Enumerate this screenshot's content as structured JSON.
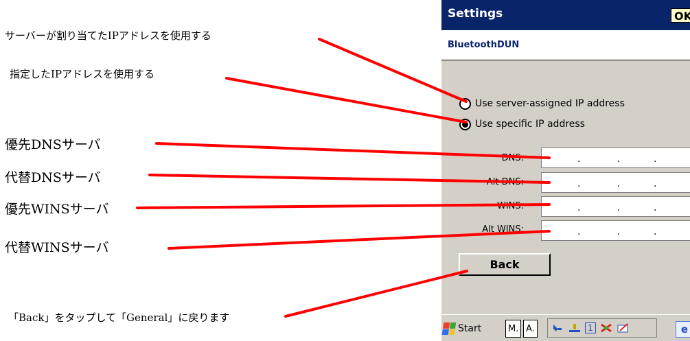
{
  "annotations": {
    "server_assigned": "サーバーが割り当てたIPアドレスを使用する",
    "specific": "指定したIPアドレスを使用する",
    "primary_dns": "優先DNSサーバ",
    "alt_dns": "代替DNSサーバ",
    "primary_wins": "優先WINSサーバ",
    "alt_wins": "代替WINSサーバ",
    "back_note": "「Back」をタップして「General」に戻ります"
  },
  "window": {
    "title": "Settings",
    "ok_label": "OK",
    "subtitle": "BluetoothDUN"
  },
  "ip_options": {
    "server_assigned_label": "Use server-assigned IP address",
    "specific_label": "Use specific IP address",
    "selected": "specific"
  },
  "fields": {
    "dns_label": "DNS:",
    "alt_dns_label": "Alt DNS:",
    "wins_label": "WINS:",
    "alt_wins_label": "Alt WINS:",
    "separator": "."
  },
  "buttons": {
    "back_label": "Back"
  },
  "taskbar": {
    "start_label": "Start",
    "tab1": "M.",
    "tab2": "A.",
    "tray_number": "1",
    "ie_glyph": "e"
  },
  "colors": {
    "annotation_line": "#ff0000",
    "titlebar": "#0a246a",
    "ok_button": "#ffffc8",
    "background": "#d4d0c8"
  }
}
